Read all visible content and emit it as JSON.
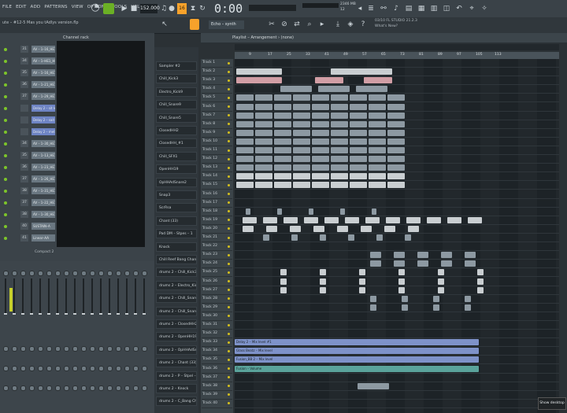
{
  "menu": [
    "FILE",
    "EDIT",
    "ADD",
    "PATTERNS",
    "VIEW",
    "OPTIONS",
    "TOOLS",
    "HELP"
  ],
  "transport": {
    "bpm": "152.000",
    "song_mode": "16",
    "time": "0:00",
    "time_sub": "M:S:CS"
  },
  "project_line": "ute – #12-5 Mas you tAdlys version.flp",
  "pattern_selector": "Echo – synth",
  "news": [
    "03/10 FL STUDIO 21.2.3",
    "What's New?"
  ],
  "cpu": {
    "mem": "2346 MB",
    "cpu": "12"
  },
  "channel_rack": {
    "title": "Channel rack",
    "channels": [
      {
        "num": "31",
        "name": "AV – 1–16_HE1",
        "blue": false
      },
      {
        "num": "34",
        "name": "AV – 1–HE1_HE",
        "blue": false
      },
      {
        "num": "35",
        "name": "AV – 1–16_HE1",
        "blue": false
      },
      {
        "num": "36",
        "name": "AV – 1–21_HE1",
        "blue": false
      },
      {
        "num": "37",
        "name": "AV – 1–29_HE1",
        "blue": false
      },
      {
        "num": "",
        "name": "Delay 2 – sit level",
        "blue": true
      },
      {
        "num": "",
        "name": "Delay 2 – sait #1",
        "blue": true
      },
      {
        "num": "",
        "name": "Delay 2 – met #1",
        "blue": true
      },
      {
        "num": "34",
        "name": "AV – 1–30_HE1",
        "blue": false
      },
      {
        "num": "35",
        "name": "AV – 1–13_HE1",
        "blue": false
      },
      {
        "num": "36",
        "name": "AV – 1–23_HE1",
        "blue": false
      },
      {
        "num": "37",
        "name": "AV – 1–26_HE1",
        "blue": false
      },
      {
        "num": "38",
        "name": "AV – 1–31_HE1",
        "blue": false
      },
      {
        "num": "37",
        "name": "AV – 1–22_HE1",
        "blue": false
      },
      {
        "num": "38",
        "name": "AV – 1–30_HE1",
        "blue": false
      },
      {
        "num": "40",
        "name": "SUSTAIN–A",
        "blue": false
      },
      {
        "num": "41",
        "name": "Linear–AA",
        "blue": false
      }
    ]
  },
  "mixer_label": "Compact 2",
  "browser_items": [
    "Sampler #2",
    "Chill_Kick3",
    "Electro_Kick9",
    "Chill_Snare9",
    "Chill_Snare5",
    "ClosedHH2",
    "ClosedHH_#1",
    "Chill_SFX1",
    "OpenHH19",
    "OpHHAdSnare2",
    "Snap3",
    "ScrRsa",
    "Chant (33)",
    "Pad DM – Stpes – 1",
    "Knock",
    "Chill Reef Bang Chant",
    "drums 2 – Chill_Kick3",
    "drums 2 – Electro_Kick9",
    "drums 2 – Chill_Snare9",
    "drums 2 – Chill_Snare5",
    "drums 2 – ClosedHH2",
    "drums 2 – OpenHH19",
    "drums 2 – OpHHAdSnare2",
    "drums 2 – Chant (33)",
    "drums 2 – P – Stpel – C",
    "drums 2 – Knock",
    "drums 2 – C_Bang Chant"
  ],
  "playlist": {
    "title": "Playlist – Arrangement › (none)",
    "ruler": [
      "9",
      "17",
      "25",
      "33",
      "41",
      "49",
      "57",
      "65",
      "73",
      "81",
      "89",
      "97",
      "105",
      "113"
    ],
    "tracks": [
      "Track 1",
      "Track 2",
      "Track 3",
      "Track 4",
      "Track 5",
      "Track 6",
      "Track 7",
      "Track 8",
      "Track 9",
      "Track 10",
      "Track 11",
      "Track 12",
      "Track 13",
      "Track 14",
      "Track 15",
      "Track 16",
      "Track 17",
      "Track 18",
      "Track 19",
      "Track 20",
      "Track 21",
      "Track 22",
      "Track 23",
      "Track 24",
      "Track 25",
      "Track 26",
      "Track 27",
      "Track 28",
      "Track 29",
      "Track 30",
      "Track 31",
      "Track 32",
      "Track 33",
      "Track 34",
      "Track 35",
      "Track 36",
      "Track 37",
      "Track 38",
      "Track 39",
      "Track 40"
    ],
    "lane_clips": [
      {
        "track": 32,
        "label": "Delay 2 – Mix level #1",
        "color": "cb"
      },
      {
        "track": 33,
        "label": "Glass Beatz – Mix level",
        "color": "cb"
      },
      {
        "track": 34,
        "label": "Fusion_BB 2 – Mix level",
        "color": "cb"
      },
      {
        "track": 35,
        "label": "Fusion – Volume",
        "color": "ct"
      }
    ]
  },
  "show_desktop": "Show desktop"
}
